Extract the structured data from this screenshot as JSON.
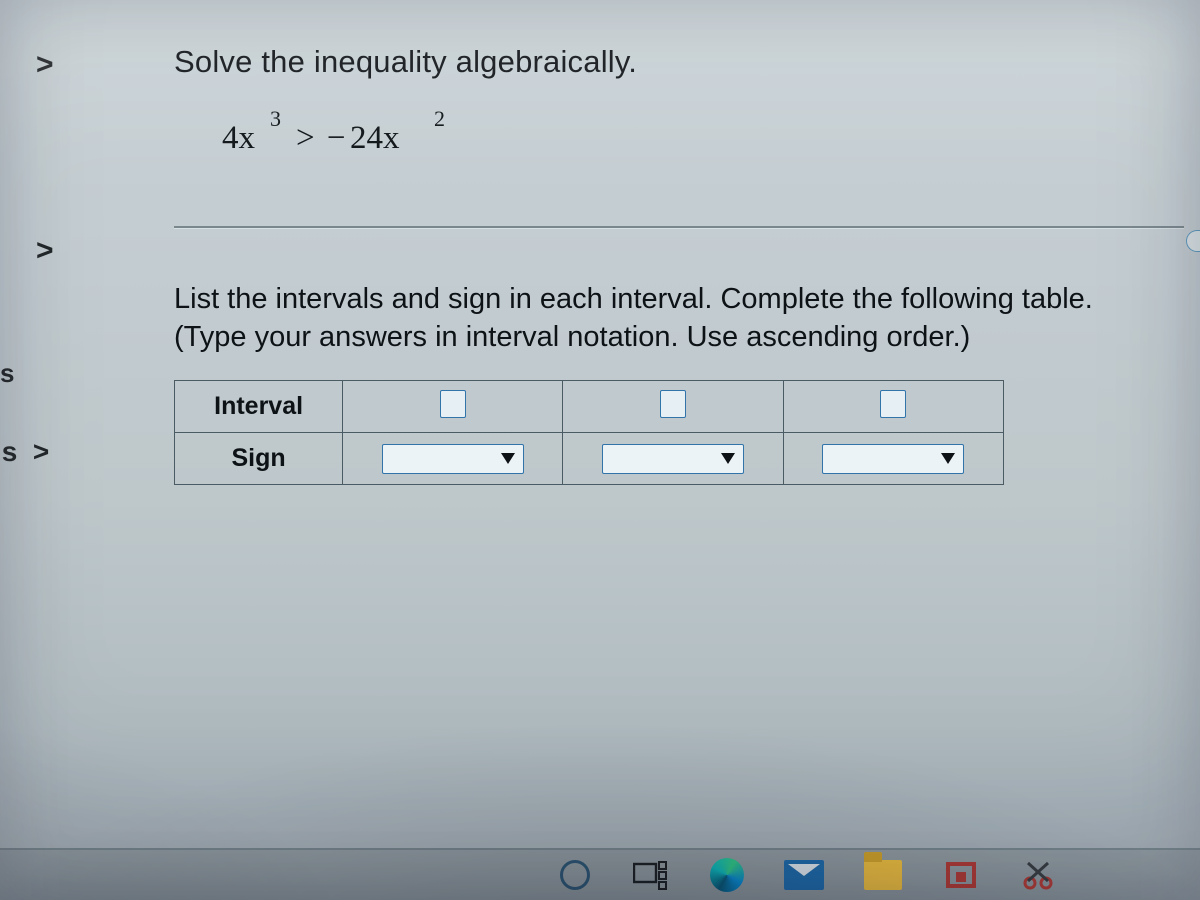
{
  "nav": {
    "item1": ">",
    "item2": ">",
    "item3_suffix": "s",
    "item4_label": "ls",
    "item4_chev": ">"
  },
  "problem": {
    "prompt": "Solve the inequality algebraically.",
    "eq_base1": "4x",
    "eq_exp1": "3",
    "eq_mid": "> −",
    "eq_base2": "24x",
    "eq_exp2": "2"
  },
  "instruction": {
    "line1": "List the intervals and sign in each interval. Complete the following table.",
    "line2": "(Type your answers in interval notation. Use ascending order.)"
  },
  "table": {
    "row1_label": "Interval",
    "row2_label": "Sign",
    "interval_values": [
      "",
      "",
      ""
    ],
    "sign_values": [
      "",
      "",
      ""
    ]
  },
  "taskbar": {
    "icons": [
      "cortana",
      "task-view",
      "edge",
      "mail",
      "file-explorer",
      "screen-recorder",
      "snipping-tool"
    ]
  }
}
